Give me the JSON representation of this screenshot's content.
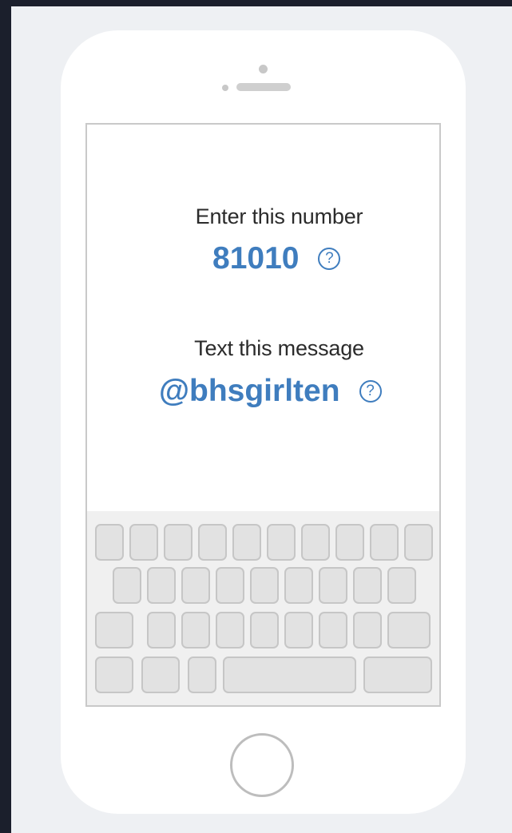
{
  "prompt": {
    "number_label": "Enter this number",
    "number_value": "81010",
    "message_label": "Text this message",
    "message_value": "@bhsgirlten",
    "help_glyph": "?"
  },
  "icons": {
    "help": "question-circle-icon"
  },
  "colors": {
    "accent": "#3f7dbe",
    "text": "#2b2b2b",
    "key_fill": "#e2e2e2",
    "key_border": "#c6c6c6"
  }
}
